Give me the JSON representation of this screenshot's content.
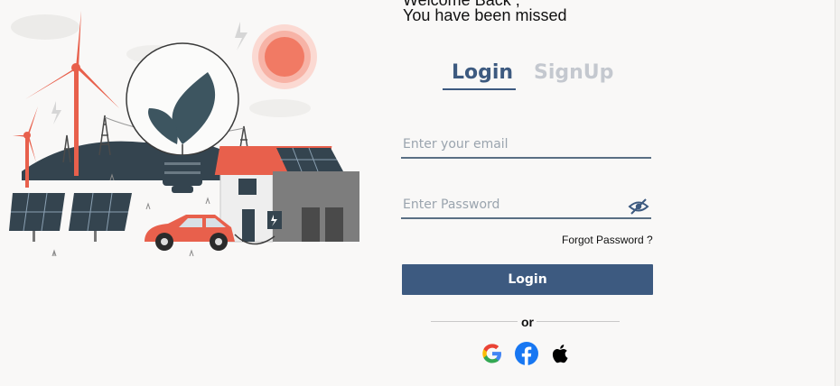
{
  "header": {
    "greeting_partial": "Welcome Back ,",
    "subtitle": "You have been missed"
  },
  "tabs": [
    {
      "label": "Login",
      "active": true
    },
    {
      "label": "SignUp",
      "active": false
    }
  ],
  "form": {
    "email_placeholder": "Enter your email",
    "email_value": "",
    "password_placeholder": "Enter Password",
    "password_value": "",
    "password_toggle_icon": "eye-slash-icon",
    "forgot_label": "Forgot Password ?",
    "login_button": "Login"
  },
  "divider": {
    "label": "or"
  },
  "social": [
    {
      "name": "google-icon"
    },
    {
      "name": "facebook-icon"
    },
    {
      "name": "apple-icon"
    }
  ],
  "colors": {
    "primary": "#3d5a80",
    "tab_inactive": "#c4c8cf",
    "facebook": "#1877f2",
    "accent_red": "#e8604c"
  }
}
